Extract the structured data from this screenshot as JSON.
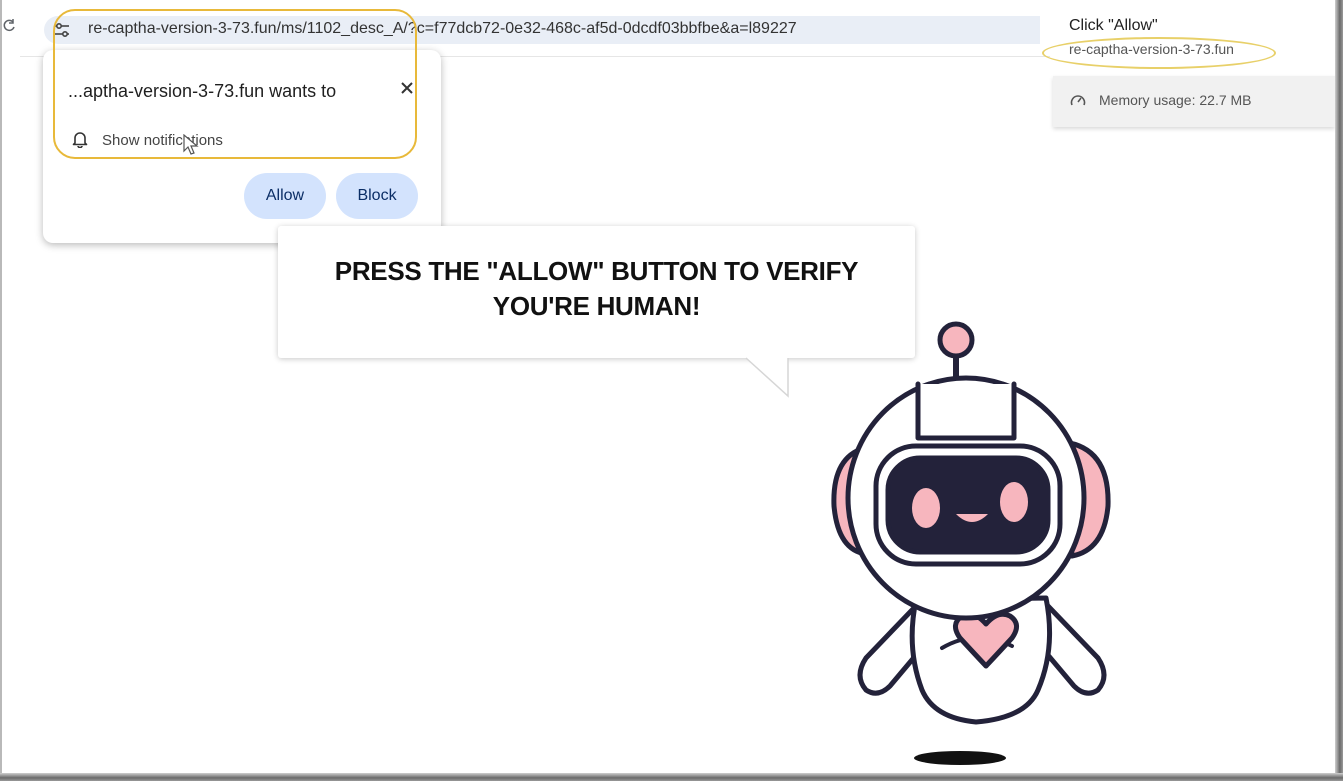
{
  "browser": {
    "url": "re-captha-version-3-73.fun/ms/1102_desc_A/?c=f77dcb72-0e32-468c-af5d-0dcdf03bbfbe&a=l89227",
    "icons": {
      "reload": "reload-icon",
      "site_settings": "tune-icon"
    }
  },
  "permission_popup": {
    "title": "...aptha-version-3-73.fun wants to",
    "permission": "Show notifications",
    "allow_label": "Allow",
    "block_label": "Block",
    "icons": {
      "close": "close-icon",
      "permission": "bell-icon"
    },
    "button_color": "#d3e3fd"
  },
  "tab_hover": {
    "title": "Click \"Allow\"",
    "domain": "re-captha-version-3-73.fun",
    "memory": "Memory usage: 22.7 MB",
    "icon": "gauge-icon"
  },
  "page": {
    "headline_line1": "PRESS THE \"ALLOW\" BUTTON TO VERIFY",
    "headline_line2": "YOU'RE HUMAN!",
    "illustration": "robot",
    "colors": {
      "robot_accent": "#f7b6be",
      "robot_outline": "#23223a",
      "highlight": "#e8b93a"
    }
  }
}
